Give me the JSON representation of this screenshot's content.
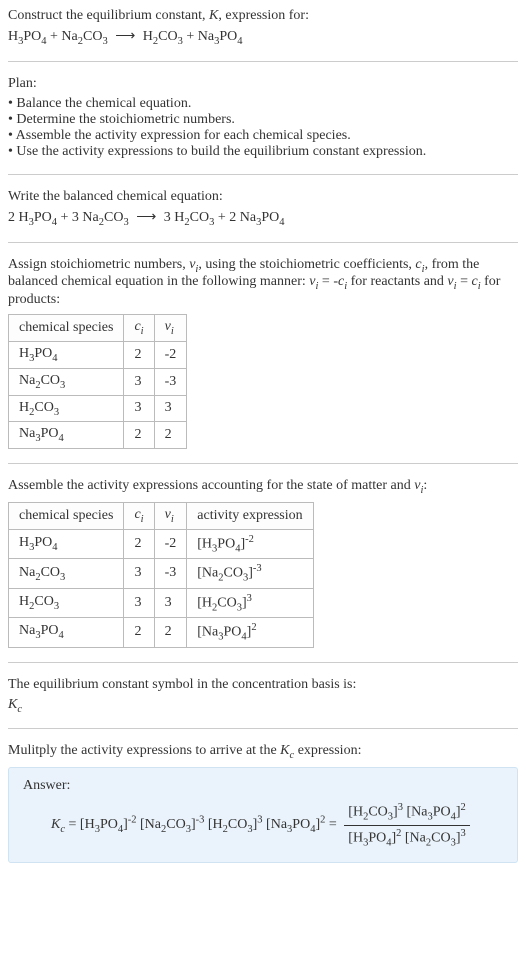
{
  "intro": {
    "line1": "Construct the equilibrium constant, K, expression for:",
    "equation": "H₃PO₄ + Na₂CO₃ ⟶ H₂CO₃ + Na₃PO₄"
  },
  "plan": {
    "heading": "Plan:",
    "items": [
      "Balance the chemical equation.",
      "Determine the stoichiometric numbers.",
      "Assemble the activity expression for each chemical species.",
      "Use the activity expressions to build the equilibrium constant expression."
    ]
  },
  "balanced": {
    "heading": "Write the balanced chemical equation:",
    "equation": "2 H₃PO₄ + 3 Na₂CO₃ ⟶ 3 H₂CO₃ + 2 Na₃PO₄"
  },
  "stoich": {
    "text1": "Assign stoichiometric numbers, νᵢ, using the stoichiometric coefficients, cᵢ, from the balanced chemical equation in the following manner: νᵢ = -cᵢ for reactants and νᵢ = cᵢ for products:",
    "headers": [
      "chemical species",
      "cᵢ",
      "νᵢ"
    ],
    "rows": [
      [
        "H₃PO₄",
        "2",
        "-2"
      ],
      [
        "Na₂CO₃",
        "3",
        "-3"
      ],
      [
        "H₂CO₃",
        "3",
        "3"
      ],
      [
        "Na₃PO₄",
        "2",
        "2"
      ]
    ]
  },
  "activity": {
    "heading": "Assemble the activity expressions accounting for the state of matter and νᵢ:",
    "headers": [
      "chemical species",
      "cᵢ",
      "νᵢ",
      "activity expression"
    ],
    "rows": [
      [
        "H₃PO₄",
        "2",
        "-2",
        "[H₃PO₄]⁻²"
      ],
      [
        "Na₂CO₃",
        "3",
        "-3",
        "[Na₂CO₃]⁻³"
      ],
      [
        "H₂CO₃",
        "3",
        "3",
        "[H₂CO₃]³"
      ],
      [
        "Na₃PO₄",
        "2",
        "2",
        "[Na₃PO₄]²"
      ]
    ]
  },
  "kc_symbol": {
    "heading": "The equilibrium constant symbol in the concentration basis is:",
    "symbol": "K_c"
  },
  "multiply": {
    "heading": "Mulitply the activity expressions to arrive at the K_c expression:"
  },
  "answer": {
    "label": "Answer:",
    "lhs": "K_c = [H₃PO₄]⁻² [Na₂CO₃]⁻³ [H₂CO₃]³ [Na₃PO₄]² =",
    "numerator": "[H₂CO₃]³ [Na₃PO₄]²",
    "denominator": "[H₃PO₄]² [Na₂CO₃]³"
  },
  "chart_data": {
    "type": "table",
    "tables": [
      {
        "title": "Stoichiometric numbers",
        "columns": [
          "chemical species",
          "c_i",
          "nu_i"
        ],
        "rows": [
          [
            "H3PO4",
            2,
            -2
          ],
          [
            "Na2CO3",
            3,
            -3
          ],
          [
            "H2CO3",
            3,
            3
          ],
          [
            "Na3PO4",
            2,
            2
          ]
        ]
      },
      {
        "title": "Activity expressions",
        "columns": [
          "chemical species",
          "c_i",
          "nu_i",
          "activity expression"
        ],
        "rows": [
          [
            "H3PO4",
            2,
            -2,
            "[H3PO4]^-2"
          ],
          [
            "Na2CO3",
            3,
            -3,
            "[Na2CO3]^-3"
          ],
          [
            "H2CO3",
            3,
            3,
            "[H2CO3]^3"
          ],
          [
            "Na3PO4",
            2,
            2,
            "[Na3PO4]^2"
          ]
        ]
      }
    ]
  }
}
